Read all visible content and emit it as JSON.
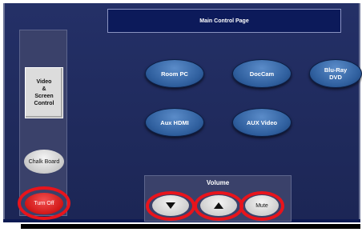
{
  "header": {
    "title": "Main Control Page"
  },
  "sidebar": {
    "video_label": "Video\n&\nScreen\nControl",
    "chalk_label": "Chalk Board",
    "turnoff_label": "Turn Off"
  },
  "sources": {
    "room_pc": "Room PC",
    "doccam": "DocCam",
    "bluray": "Blu-Ray\nDVD",
    "aux_hdmi": "Aux HDMI",
    "aux_video": "AUX Video"
  },
  "volume": {
    "label": "Volume",
    "down_icon": "down-triangle",
    "up_icon": "up-triangle",
    "mute_label": "Mute"
  },
  "colors": {
    "background": "#1f2a5c",
    "source_button": "#2f5f9e",
    "highlight_ring": "#e8141c",
    "turnoff": "#d11717"
  }
}
